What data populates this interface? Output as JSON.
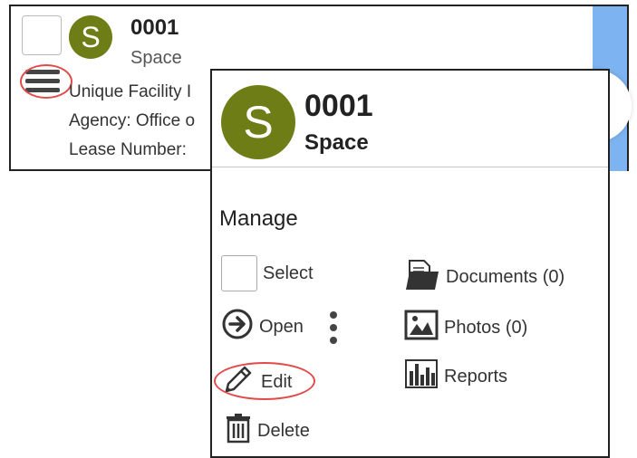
{
  "card": {
    "avatar_letter": "S",
    "title": "0001",
    "subtitle": "Space",
    "line1": "Unique Facility I",
    "line2": "Agency: Office o",
    "line3": "Lease Number:"
  },
  "popup": {
    "avatar_letter": "S",
    "title": "0001",
    "subtitle": "Space",
    "section_title": "Manage",
    "actions": {
      "select": "Select",
      "open": "Open",
      "edit": "Edit",
      "delete": "Delete",
      "documents": "Documents (0)",
      "photos": "Photos (0)",
      "reports": "Reports"
    }
  },
  "colors": {
    "avatar": "#6e7d16",
    "highlight_ring": "#e24a4a",
    "card_accent": "#7db3f0"
  },
  "icons": {
    "menu": "hamburger-menu-icon",
    "open": "arrow-right-circle-icon",
    "edit": "pencil-icon",
    "delete": "trash-icon",
    "documents": "folder-documents-icon",
    "photos": "photo-icon",
    "reports": "bar-chart-icon",
    "more": "kebab-menu-icon"
  }
}
